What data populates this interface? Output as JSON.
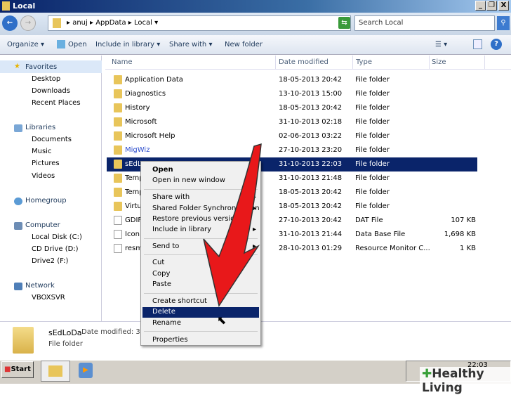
{
  "window": {
    "title": "Local"
  },
  "address": {
    "segments": [
      "anuj",
      "AppData",
      "Local"
    ],
    "search_placeholder": "Search Local"
  },
  "toolbar": {
    "organize": "Organize",
    "open": "Open",
    "include": "Include in library",
    "share": "Share with",
    "new_folder": "New folder"
  },
  "sidebar": {
    "favorites": "Favorites",
    "fav_items": [
      "Desktop",
      "Downloads",
      "Recent Places"
    ],
    "libraries": "Libraries",
    "lib_items": [
      "Documents",
      "Music",
      "Pictures",
      "Videos"
    ],
    "homegroup": "Homegroup",
    "computer": "Computer",
    "comp_items": [
      "Local Disk (C:)",
      "CD Drive (D:)",
      "Drive2 (F:)"
    ],
    "network": "Network",
    "net_items": [
      "VBOXSVR"
    ]
  },
  "columns": {
    "name": "Name",
    "date": "Date modified",
    "type": "Type",
    "size": "Size"
  },
  "files": [
    {
      "name": "Application Data",
      "date": "18-05-2013 20:42",
      "type": "File folder",
      "size": ""
    },
    {
      "name": "Diagnostics",
      "date": "13-10-2013 15:00",
      "type": "File folder",
      "size": ""
    },
    {
      "name": "History",
      "date": "18-05-2013 20:42",
      "type": "File folder",
      "size": ""
    },
    {
      "name": "Microsoft",
      "date": "31-10-2013 02:18",
      "type": "File folder",
      "size": ""
    },
    {
      "name": "Microsoft Help",
      "date": "02-06-2013 03:22",
      "type": "File folder",
      "size": ""
    },
    {
      "name": "MigWiz",
      "date": "27-10-2013 23:20",
      "type": "File folder",
      "size": ""
    },
    {
      "name": "sEdL",
      "date": "31-10-2013 22:03",
      "type": "File folder",
      "size": ""
    },
    {
      "name": "Temp",
      "date": "31-10-2013 21:48",
      "type": "File folder",
      "size": ""
    },
    {
      "name": "Temp",
      "date": "18-05-2013 20:42",
      "type": "File folder",
      "size": ""
    },
    {
      "name": "Virtu",
      "date": "18-05-2013 20:42",
      "type": "File folder",
      "size": ""
    },
    {
      "name": "GDIF",
      "date": "27-10-2013 20:42",
      "type": "DAT File",
      "size": "107 KB"
    },
    {
      "name": "Icon",
      "date": "31-10-2013 21:44",
      "type": "Data Base File",
      "size": "1,698 KB"
    },
    {
      "name": "resm",
      "date": "28-10-2013 01:29",
      "type": "Resource Monitor C...",
      "size": "1 KB"
    }
  ],
  "context_menu": [
    {
      "label": "Open",
      "bold": true
    },
    {
      "label": "Open in new window"
    },
    {
      "sep": true
    },
    {
      "label": "Share with",
      "sub": true
    },
    {
      "label": "Shared Folder Synchronization",
      "sub": true
    },
    {
      "label": "Restore previous versions"
    },
    {
      "label": "Include in library",
      "sub": true
    },
    {
      "sep": true
    },
    {
      "label": "Send to",
      "sub": true
    },
    {
      "sep": true
    },
    {
      "label": "Cut"
    },
    {
      "label": "Copy"
    },
    {
      "label": "Paste"
    },
    {
      "sep": true
    },
    {
      "label": "Create shortcut"
    },
    {
      "label": "Delete",
      "highlight": true
    },
    {
      "label": "Rename"
    },
    {
      "sep": true
    },
    {
      "label": "Properties"
    }
  ],
  "details": {
    "name": "sEdLoDa",
    "date_label": "Date modified: 31-",
    "type": "File folder"
  },
  "taskbar": {
    "start": "Start",
    "clock": "22:03"
  },
  "watermark": "Healthy Living"
}
